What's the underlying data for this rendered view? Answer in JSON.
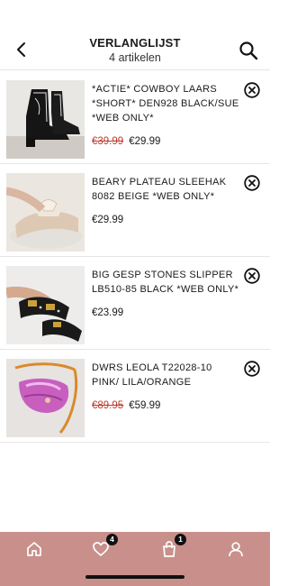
{
  "header": {
    "title": "VERLANGLIJST",
    "subtitle": "4 artikelen"
  },
  "items": [
    {
      "name": "*ACTIE* COWBOY LAARS *SHORT* DEN928 BLACK/SUE *WEB ONLY*",
      "old_price": "€39.99",
      "price": "€29.99"
    },
    {
      "name": "BEARY PLATEAU SLEEHAK 8082 BEIGE *WEB ONLY*",
      "old_price": "",
      "price": "€29.99"
    },
    {
      "name": "BIG GESP STONES SLIPPER LB510-85 BLACK *WEB ONLY*",
      "old_price": "",
      "price": "€23.99"
    },
    {
      "name": "DWRS LEOLA T22028-10 PINK/ LILA/ORANGE",
      "old_price": "€89.95",
      "price": "€59.99"
    }
  ],
  "tabbar": {
    "wishlist_count": "4",
    "bag_count": "1"
  },
  "colors": {
    "accent": "#c9908b",
    "sale_price": "#c0392b"
  }
}
